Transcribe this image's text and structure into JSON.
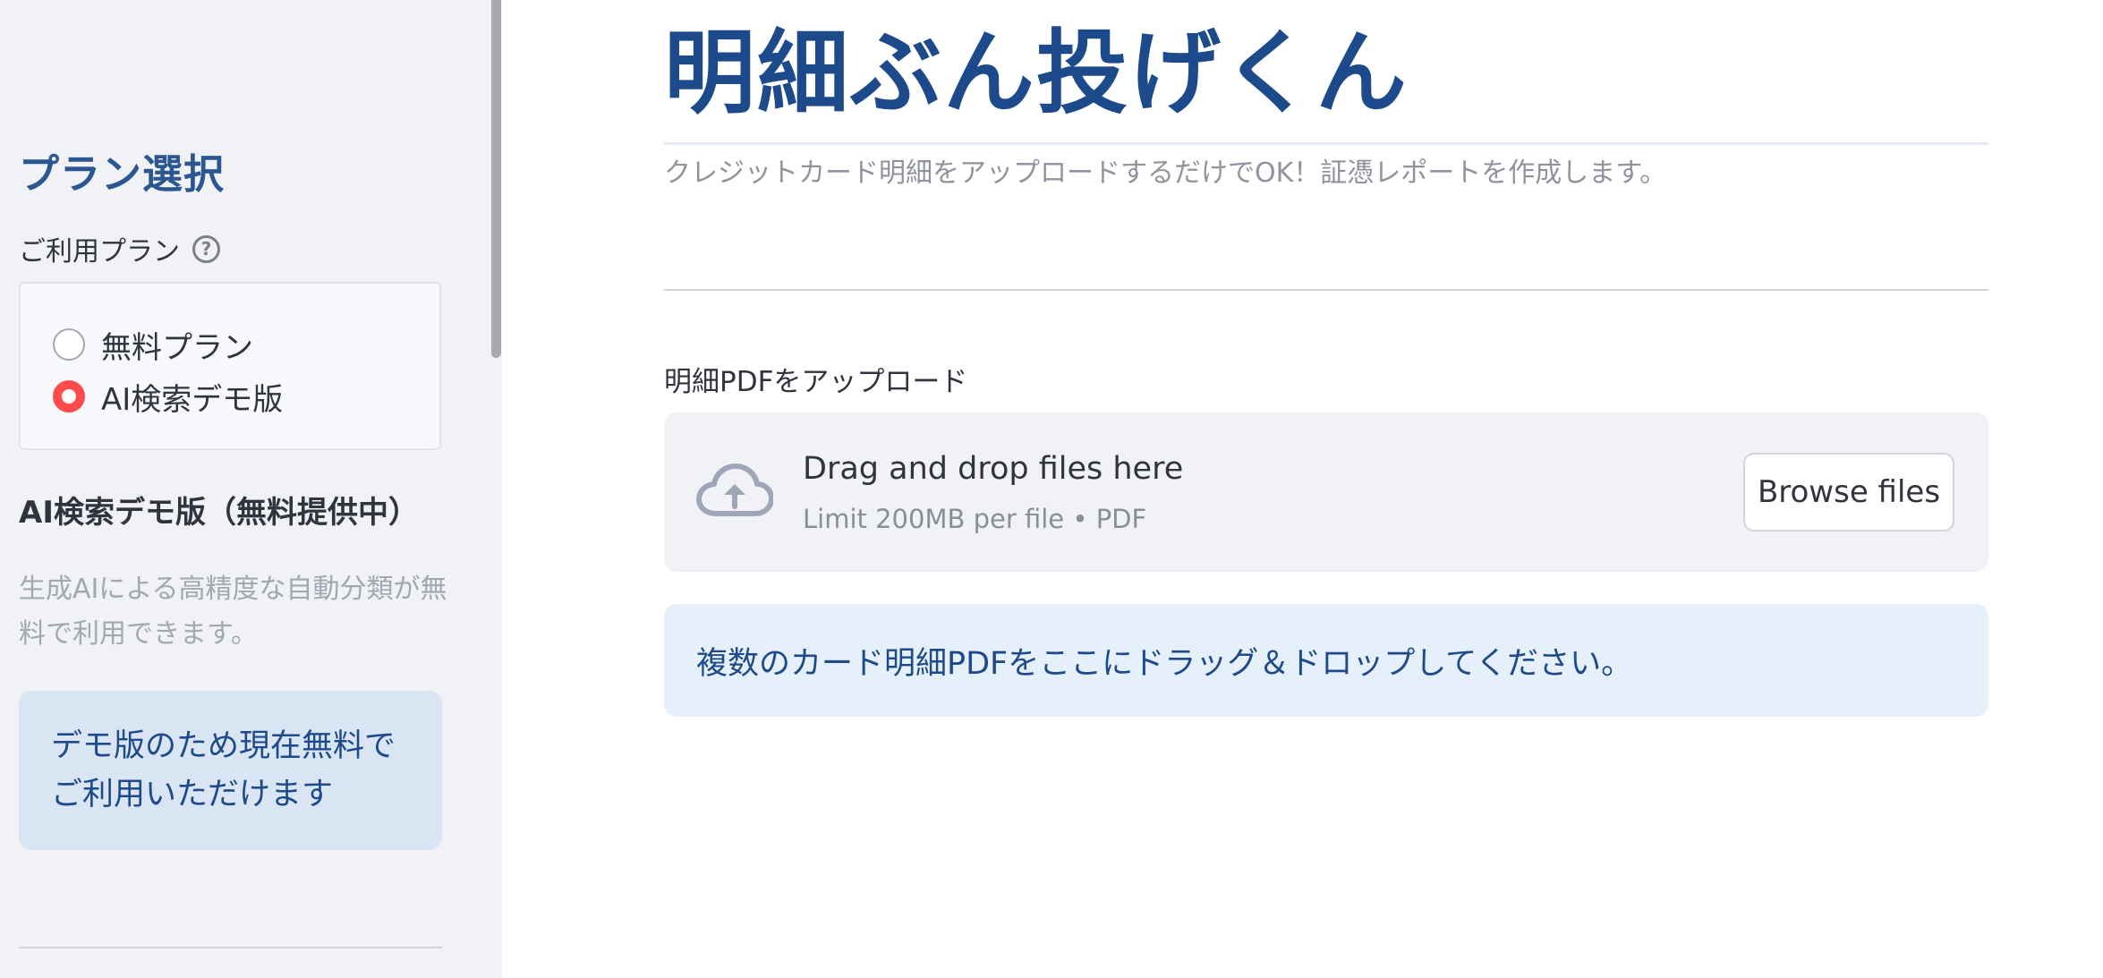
{
  "app": {
    "title": "明細ぶん投げくん",
    "subtitle": "クレジットカード明細をアップロードするだけでOK！証憑レポートを作成します。"
  },
  "sidebar": {
    "heading": "プラン選択",
    "plan_label": "ご利用プラン",
    "help_icon": "question-circle-icon",
    "plan_options": [
      {
        "label": "無料プラン",
        "selected": false
      },
      {
        "label": "AI検索デモ版",
        "selected": true
      }
    ],
    "demo_heading": "AI検索デモ版（無料提供中）",
    "demo_description": "生成AIによる高精度な自動分類が無料で利用できます。",
    "demo_info": "デモ版のため現在無料でご利用いただけます"
  },
  "uploader": {
    "label": "明細PDFをアップロード",
    "icon": "cloud-upload-icon",
    "drop_text": "Drag and drop files here",
    "limit_text": "Limit 200MB per file • PDF",
    "browse_label": "Browse files"
  },
  "info_message": "複数のカード明細PDFをここにドラッグ＆ドロップしてください。",
  "colors": {
    "accent": "#ff4b4b",
    "title": "#1c4a8b",
    "sidebar_bg": "#f0f2f6",
    "info_bg": "#e6f0fb"
  }
}
